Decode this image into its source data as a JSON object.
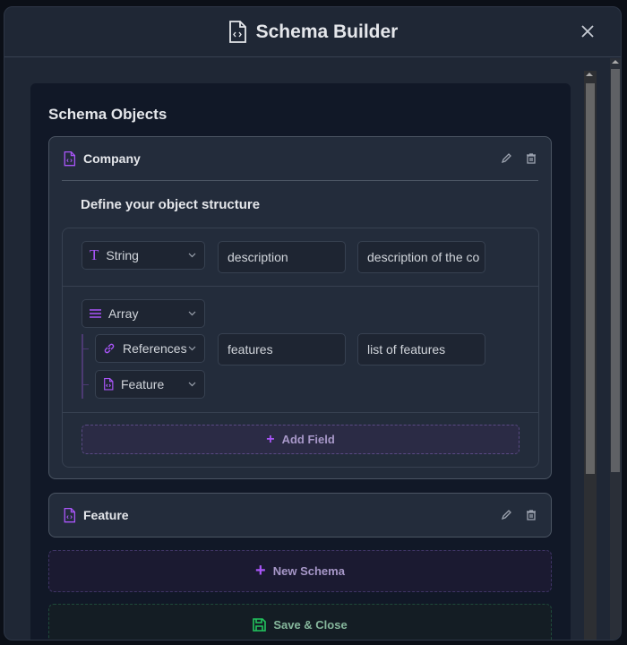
{
  "header": {
    "title": "Schema Builder",
    "icon": "file-code-icon",
    "close_icon": "close-icon"
  },
  "panel": {
    "title": "Schema Objects"
  },
  "schemas": [
    {
      "name": "Company",
      "expanded": true,
      "define_label": "Define your object structure",
      "fields": [
        {
          "type": "String",
          "name": "description",
          "description": "description of the co"
        },
        {
          "type": "Array",
          "children": [
            {
              "type": "References",
              "name": "features",
              "description": "list of features"
            },
            {
              "type": "Feature"
            }
          ]
        }
      ],
      "add_field_label": "Add Field"
    },
    {
      "name": "Feature",
      "expanded": false
    }
  ],
  "actions": {
    "new_schema": "New Schema",
    "save_close": "Save & Close"
  },
  "colors": {
    "accent": "#a855f7",
    "save": "#22c55e",
    "bg": "#111827",
    "card": "#232c3b"
  }
}
